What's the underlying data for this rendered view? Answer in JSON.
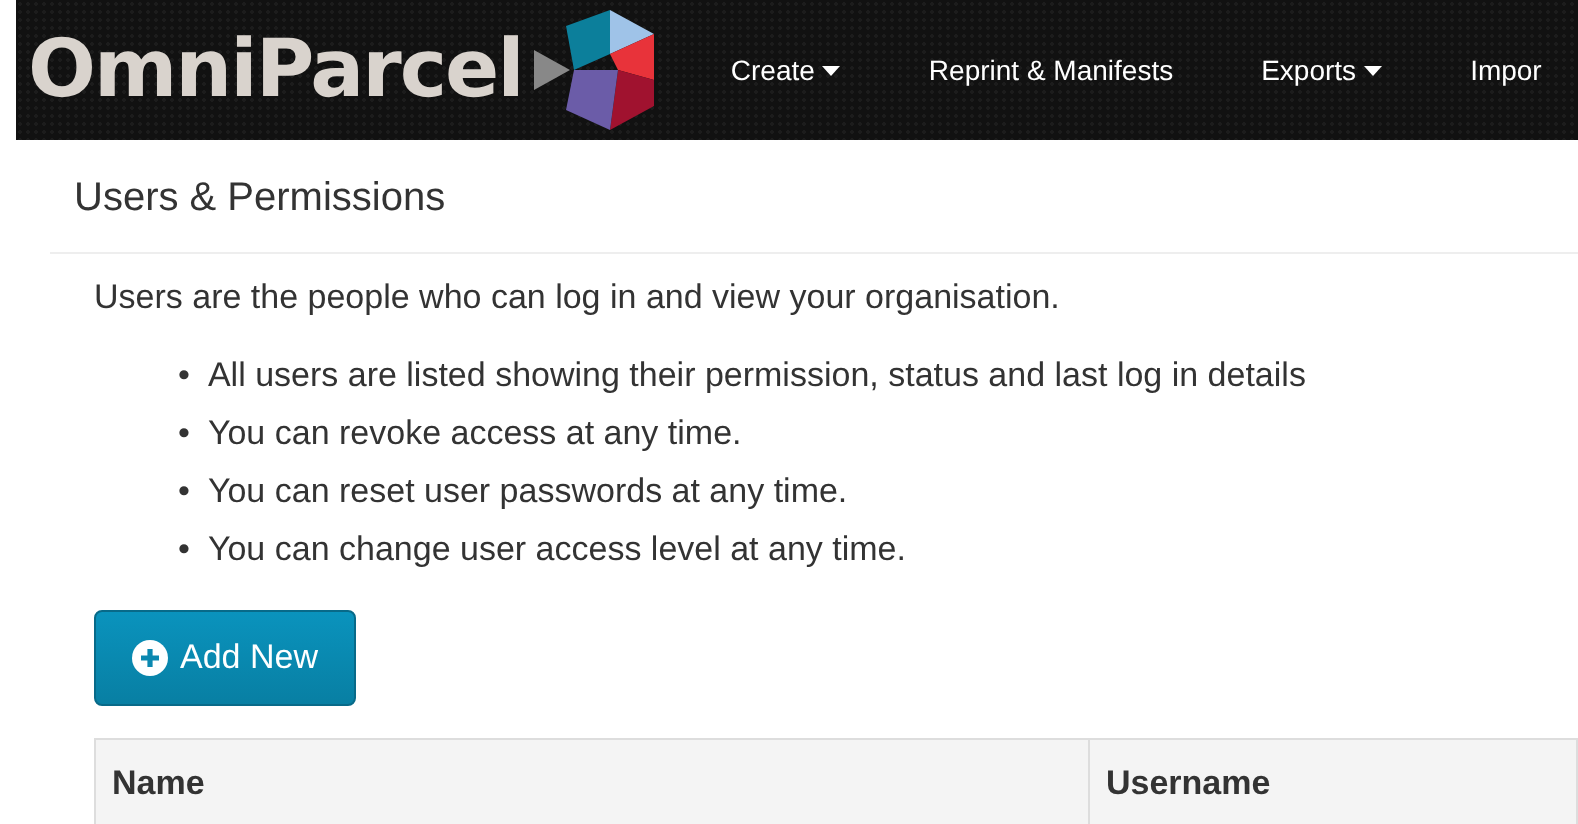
{
  "brand": {
    "name": "OmniParcel"
  },
  "nav": [
    {
      "label": "Create",
      "dropdown": true
    },
    {
      "label": "Reprint & Manifests",
      "dropdown": false
    },
    {
      "label": "Exports",
      "dropdown": true
    },
    {
      "label": "Impor",
      "dropdown": false
    }
  ],
  "page": {
    "title": "Users & Permissions",
    "intro": "Users are the people who can log in and view your organisation.",
    "bullets": [
      {
        "marker": "•",
        "text": "All users are listed showing their permission, status and last log in details"
      },
      {
        "marker": "•",
        "text": "You can revoke access at any time."
      },
      {
        "marker": "•",
        "text": "You can reset user passwords at any time."
      },
      {
        "marker": "•",
        "text": "You can change user access level at any time."
      }
    ],
    "add_button": "Add New"
  },
  "table": {
    "columns": [
      "Name",
      "Username"
    ]
  }
}
